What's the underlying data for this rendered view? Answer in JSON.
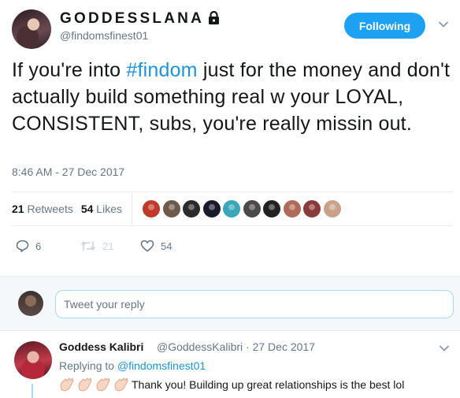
{
  "tweet": {
    "display_name": "GODDESSLANA",
    "handle": "@findomsfinest01",
    "follow_label": "Following",
    "text_before": "If you're into ",
    "hashtag": "#findom",
    "text_after": " just for the money and don't actually build something real w your LOYAL, CONSISTENT, subs, you're really missin out.",
    "timestamp": "8:46 AM - 27 Dec 2017",
    "retweets_count": "21",
    "retweets_label": "Retweets",
    "likes_count": "54",
    "likes_label": "Likes",
    "actions": {
      "reply_count": "6",
      "retweet_count": "21",
      "like_count": "54"
    },
    "liker_avatar_colors": [
      "#c0392b",
      "#6d5a4a",
      "#2b2b2b",
      "#1a1a2e",
      "#3aa6b9",
      "#4a4a4a",
      "#222222",
      "#b06a5a",
      "#8a3a3a",
      "#caa28a"
    ]
  },
  "composer": {
    "placeholder": "Tweet your reply"
  },
  "reply": {
    "name": "Goddess Kalibri",
    "meta": "@GoddessKalibri · 27 Dec 2017",
    "replying_prefix": "Replying to ",
    "replying_handle": "@findomsfinest01",
    "text": "Thank you! Building up great relationships is the best lol"
  },
  "colors": {
    "accent": "#1da1f2",
    "link": "#1b95e0",
    "muted": "#657786"
  }
}
